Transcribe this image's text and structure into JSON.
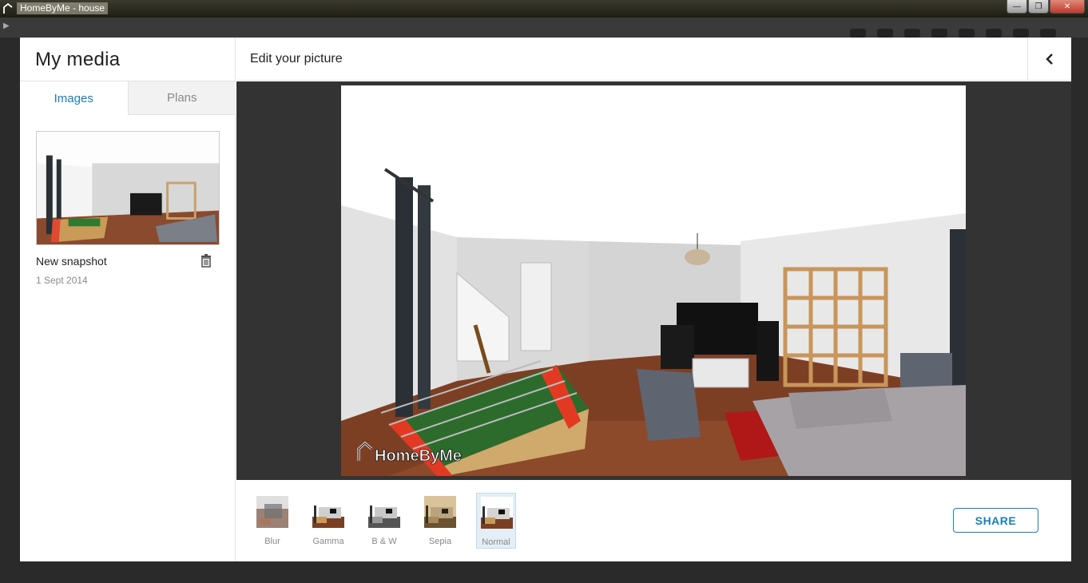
{
  "window": {
    "title": "HomeByMe - house"
  },
  "modal": {
    "sidebar": {
      "title": "My media",
      "tabs": [
        {
          "label": "Images",
          "active": true
        },
        {
          "label": "Plans",
          "active": false
        }
      ],
      "items": [
        {
          "name": "New snapshot",
          "date": "1 Sept 2014"
        }
      ]
    },
    "main": {
      "title": "Edit your picture",
      "watermark": "HomeByMe",
      "filters": [
        {
          "label": "Blur",
          "selected": false
        },
        {
          "label": "Gamma",
          "selected": false
        },
        {
          "label": "B & W",
          "selected": false
        },
        {
          "label": "Sepia",
          "selected": false
        },
        {
          "label": "Normal",
          "selected": true
        }
      ],
      "share_label": "SHARE"
    }
  },
  "icons": {
    "back": "chevron-left-icon",
    "trash": "trash-icon",
    "app": "house-icon"
  },
  "colors": {
    "accent": "#1a7fb5",
    "preview_background": "#333333",
    "sepia": "#c8a878"
  }
}
